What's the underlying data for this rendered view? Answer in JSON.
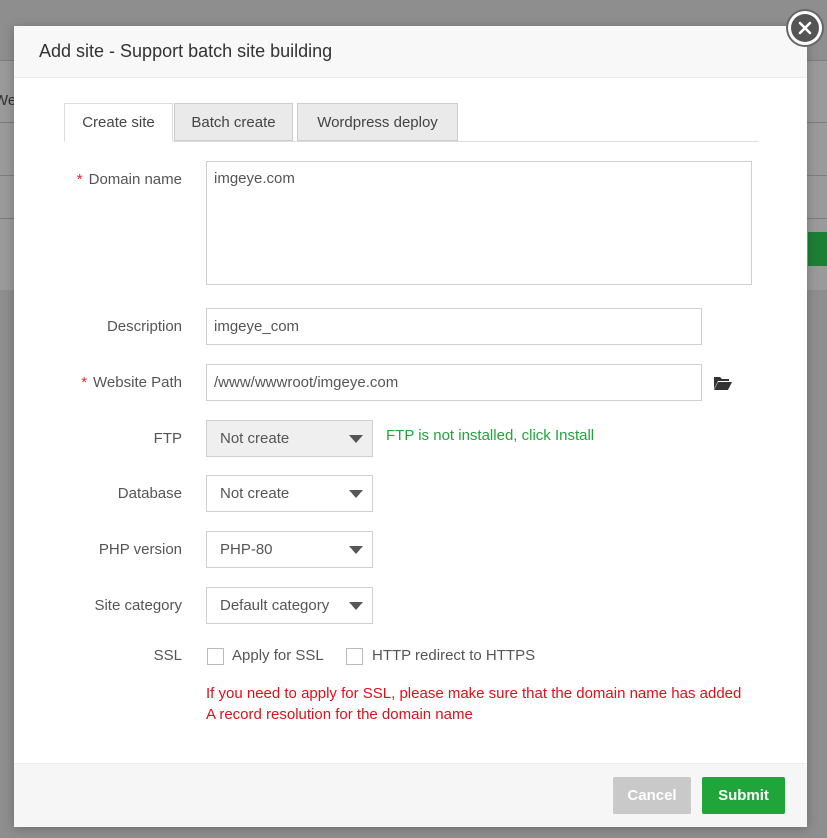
{
  "background": {
    "partial_text": "We"
  },
  "dialog": {
    "title": "Add site - Support batch site building",
    "tabs": [
      {
        "label": "Create site",
        "active": true
      },
      {
        "label": "Batch create",
        "active": false
      },
      {
        "label": "Wordpress deploy",
        "active": false
      }
    ],
    "form": {
      "domain": {
        "label": "Domain name",
        "value": "imgeye.com",
        "required": true
      },
      "description": {
        "label": "Description",
        "value": "imgeye_com"
      },
      "path": {
        "label": "Website Path",
        "value": "/www/wwwroot/imgeye.com",
        "required": true
      },
      "ftp": {
        "label": "FTP",
        "value": "Not create",
        "hint": "FTP is not installed, click Install"
      },
      "database": {
        "label": "Database",
        "value": "Not create"
      },
      "php": {
        "label": "PHP version",
        "value": "PHP-80"
      },
      "category": {
        "label": "Site category",
        "value": "Default category"
      },
      "ssl": {
        "label": "SSL",
        "apply_label": "Apply for SSL",
        "apply_checked": false,
        "redirect_label": "HTTP redirect to HTTPS",
        "redirect_checked": false,
        "warning": "If you need to apply for SSL, please make sure that the domain name has added A record resolution for the domain name"
      }
    },
    "footer": {
      "cancel_label": "Cancel",
      "submit_label": "Submit"
    }
  },
  "colors": {
    "accent_green": "#20a53a",
    "warning_red": "#e0101a",
    "required_star": "#e23"
  }
}
